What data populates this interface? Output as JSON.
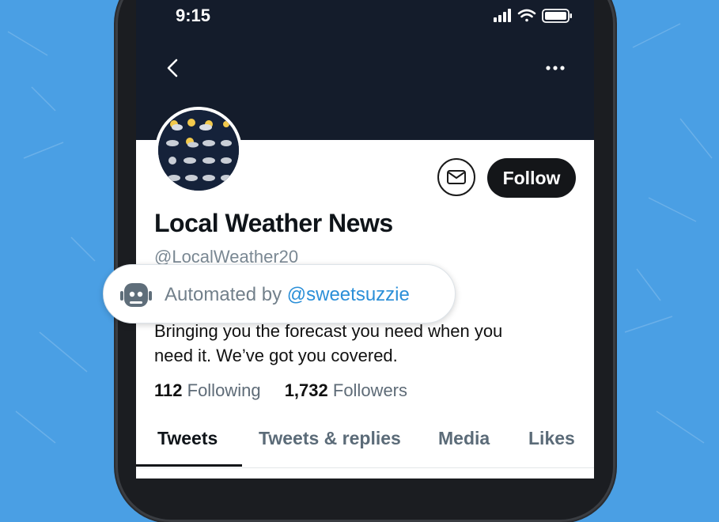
{
  "status": {
    "time": "9:15"
  },
  "profile": {
    "name": "Local Weather News",
    "handle": "@LocalWeather20",
    "bio_line1": "Bringing you the forecast you need when you",
    "bio_line2": "need it.  We’ve got you covered.",
    "following_count": "112",
    "following_label": "Following",
    "followers_count": "1,732",
    "followers_label": "Followers"
  },
  "actions": {
    "follow_label": "Follow"
  },
  "automation": {
    "prefix": "Automated by",
    "account": "@sweetsuzzie"
  },
  "tabs": [
    {
      "label": "Tweets",
      "active": true
    },
    {
      "label": "Tweets & replies",
      "active": false
    },
    {
      "label": "Media",
      "active": false
    },
    {
      "label": "Likes",
      "active": false
    }
  ],
  "colors": {
    "background": "#4a9fe4",
    "header": "#141c2b",
    "link": "#2b8fd8",
    "button": "#141619"
  },
  "icons": [
    "back-arrow-icon",
    "more-icon",
    "signal-icon",
    "wifi-icon",
    "battery-icon",
    "mail-icon",
    "robot-icon"
  ]
}
